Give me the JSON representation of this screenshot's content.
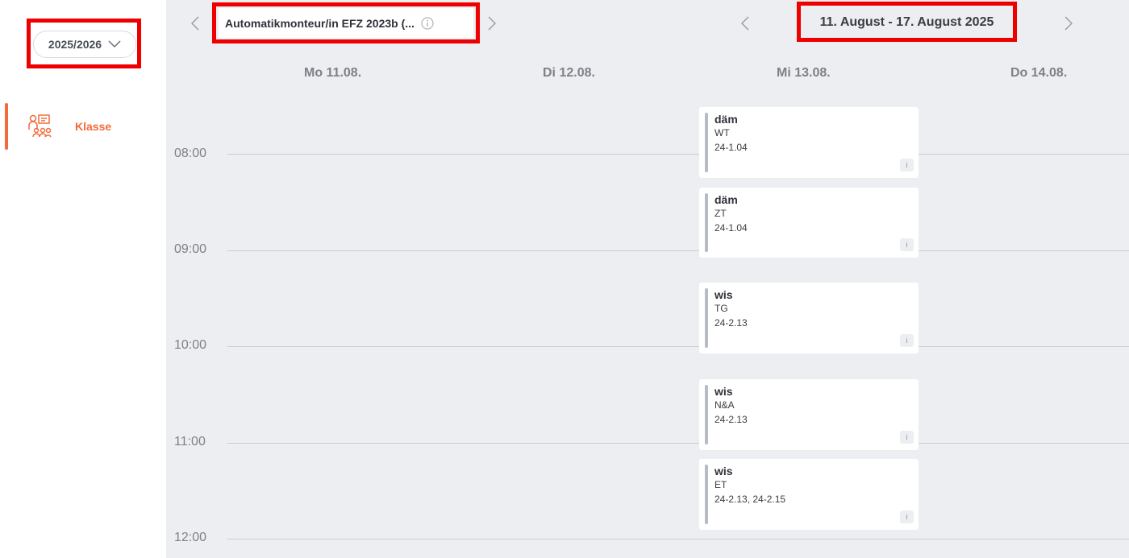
{
  "sidebar": {
    "school_year": "2025/2026",
    "nav_item_label": "Klasse"
  },
  "header": {
    "class_name": "Automatikmonteur/in EFZ 2023b (...",
    "week_range": "11. August - 17. August 2025"
  },
  "days": [
    "Mo 11.08.",
    "Di 12.08.",
    "Mi 13.08.",
    "Do 14.08."
  ],
  "times": [
    "08:00",
    "09:00",
    "10:00",
    "11:00",
    "12:00"
  ],
  "lessons": [
    {
      "teacher": "däm",
      "subject": "WT",
      "room": "24-1.04",
      "info": "i"
    },
    {
      "teacher": "däm",
      "subject": "ZT",
      "room": "24-1.04",
      "info": "i"
    },
    {
      "teacher": "wis",
      "subject": "TG",
      "room": "24-2.13",
      "info": "i"
    },
    {
      "teacher": "wis",
      "subject": "N&A",
      "room": "24-2.13",
      "info": "i"
    },
    {
      "teacher": "wis",
      "subject": "ET",
      "room": "24-2.13, 24-2.15",
      "info": "i"
    }
  ],
  "colors": {
    "accent": "#f26b3a",
    "highlight": "#ee0000",
    "calendar_bg": "#eceef1"
  }
}
